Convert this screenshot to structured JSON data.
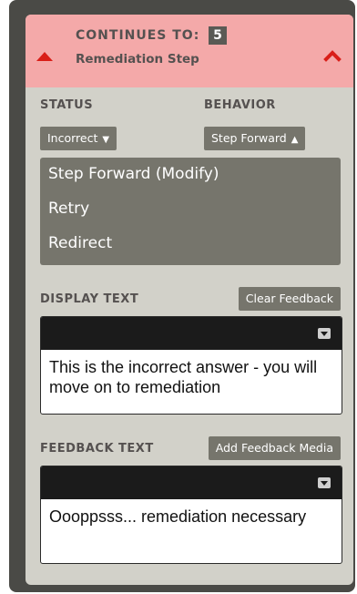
{
  "header": {
    "continues_to_label": "CONTINUES TO:",
    "step_number": "5",
    "step_name": "Remediation Step",
    "accent_color": "#d91e18"
  },
  "status": {
    "label": "STATUS",
    "value": "Incorrect"
  },
  "behavior": {
    "label": "BEHAVIOR",
    "value": "Step Forward",
    "options": [
      "Step Forward (Modify)",
      "Retry",
      "Redirect"
    ]
  },
  "display_text": {
    "label": "DISPLAY TEXT",
    "action_button": "Clear Feedback",
    "content": "This is the incorrect answer - you will move on to remediation"
  },
  "feedback_text": {
    "label": "FEEDBACK TEXT",
    "action_button": "Add Feedback Media",
    "content": "Oooppsss... remediation necessary"
  }
}
